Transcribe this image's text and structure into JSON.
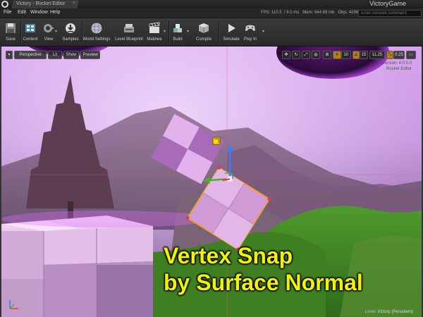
{
  "window": {
    "tab_title": "Victory - Rocket Editor",
    "tab_close": "×",
    "project_name": "VictoryGame"
  },
  "menu": {
    "items": [
      "File",
      "Edit",
      "Window",
      "Help"
    ]
  },
  "stats": {
    "fps": "FPS: 110.5",
    "ms": "9.0 ms",
    "mem": "Mem: 644.89 mb",
    "objs": "Objs: 42961"
  },
  "console": {
    "placeholder": "Enter console command"
  },
  "toolbar": {
    "buttons": [
      {
        "label": "Save",
        "icon": "save-icon"
      },
      {
        "label": "Content",
        "icon": "content-browser-icon"
      },
      {
        "label": "View",
        "icon": "view-icon"
      },
      {
        "label": "Samples",
        "icon": "samples-icon"
      },
      {
        "label": "World Settings",
        "icon": "world-settings-icon"
      },
      {
        "label": "Level Blueprint",
        "icon": "level-blueprint-icon"
      },
      {
        "label": "Matinee",
        "icon": "matinee-icon"
      },
      {
        "label": "Build",
        "icon": "build-icon"
      },
      {
        "label": "Compile",
        "icon": "compile-icon"
      },
      {
        "label": "Simulate",
        "icon": "simulate-icon"
      },
      {
        "label": "Play In",
        "icon": "play-icon"
      }
    ]
  },
  "viewport": {
    "mode_buttons": [
      "Perspective",
      "Lit",
      "Show",
      "Preview"
    ],
    "grid_snap": "10",
    "rot_snap": "15",
    "rot_snap_deg": "11.25",
    "scale_snap": "0.25",
    "version_line1": "Version: 4.0.0.0",
    "version_line2": "Rocket Editor",
    "level_key": "Level:",
    "level_value": "Victory (Persistent)"
  },
  "caption": {
    "line1": "Vertex Snap",
    "line2": "by Surface Normal"
  },
  "colors": {
    "caption": "#f3f300",
    "accent_orange": "#e89a1c"
  }
}
